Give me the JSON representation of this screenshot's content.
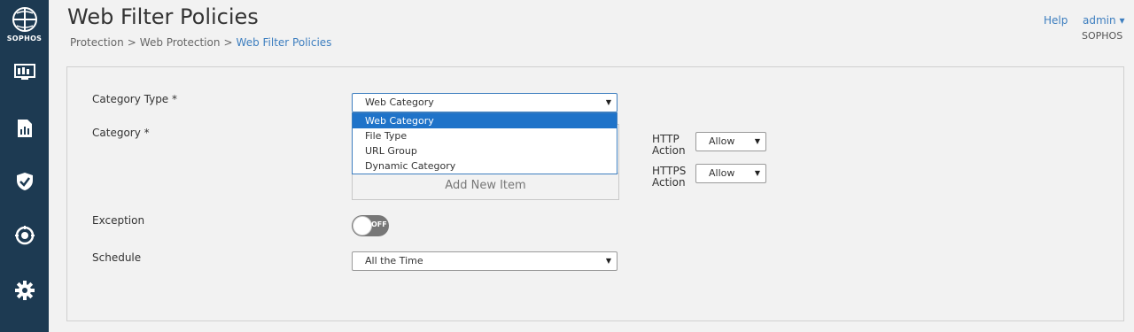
{
  "sidebar": {
    "brand": "SOPHOS",
    "items": [
      {
        "icon": "monitor-dashboard-icon"
      },
      {
        "icon": "reports-icon"
      },
      {
        "icon": "shield-check-icon"
      },
      {
        "icon": "protection-gear-icon"
      },
      {
        "icon": "settings-gear-icon"
      }
    ]
  },
  "header": {
    "title": "Web Filter Policies",
    "breadcrumb": [
      "Protection",
      "Web Protection",
      "Web Filter Policies"
    ],
    "help": "Help",
    "user": "admin",
    "user_caret": "▾",
    "org": "SOPHOS"
  },
  "form": {
    "category_type_label": "Category Type *",
    "category_type_value": "Web Category",
    "category_type_options": [
      "Web Category",
      "File Type",
      "URL Group",
      "Dynamic Category"
    ],
    "category_label": "Category *",
    "add_new_item": "Add New Item",
    "http_action_label": "HTTP Action",
    "http_action_value": "Allow",
    "https_action_label": "HTTPS Action",
    "https_action_value": "Allow",
    "exception_label": "Exception",
    "exception_toggle": "OFF",
    "schedule_label": "Schedule",
    "schedule_value": "All the Time"
  },
  "colors": {
    "sidebar": "#1d3a52",
    "link": "#3d7ebf",
    "selected_option": "#1f73c9"
  }
}
